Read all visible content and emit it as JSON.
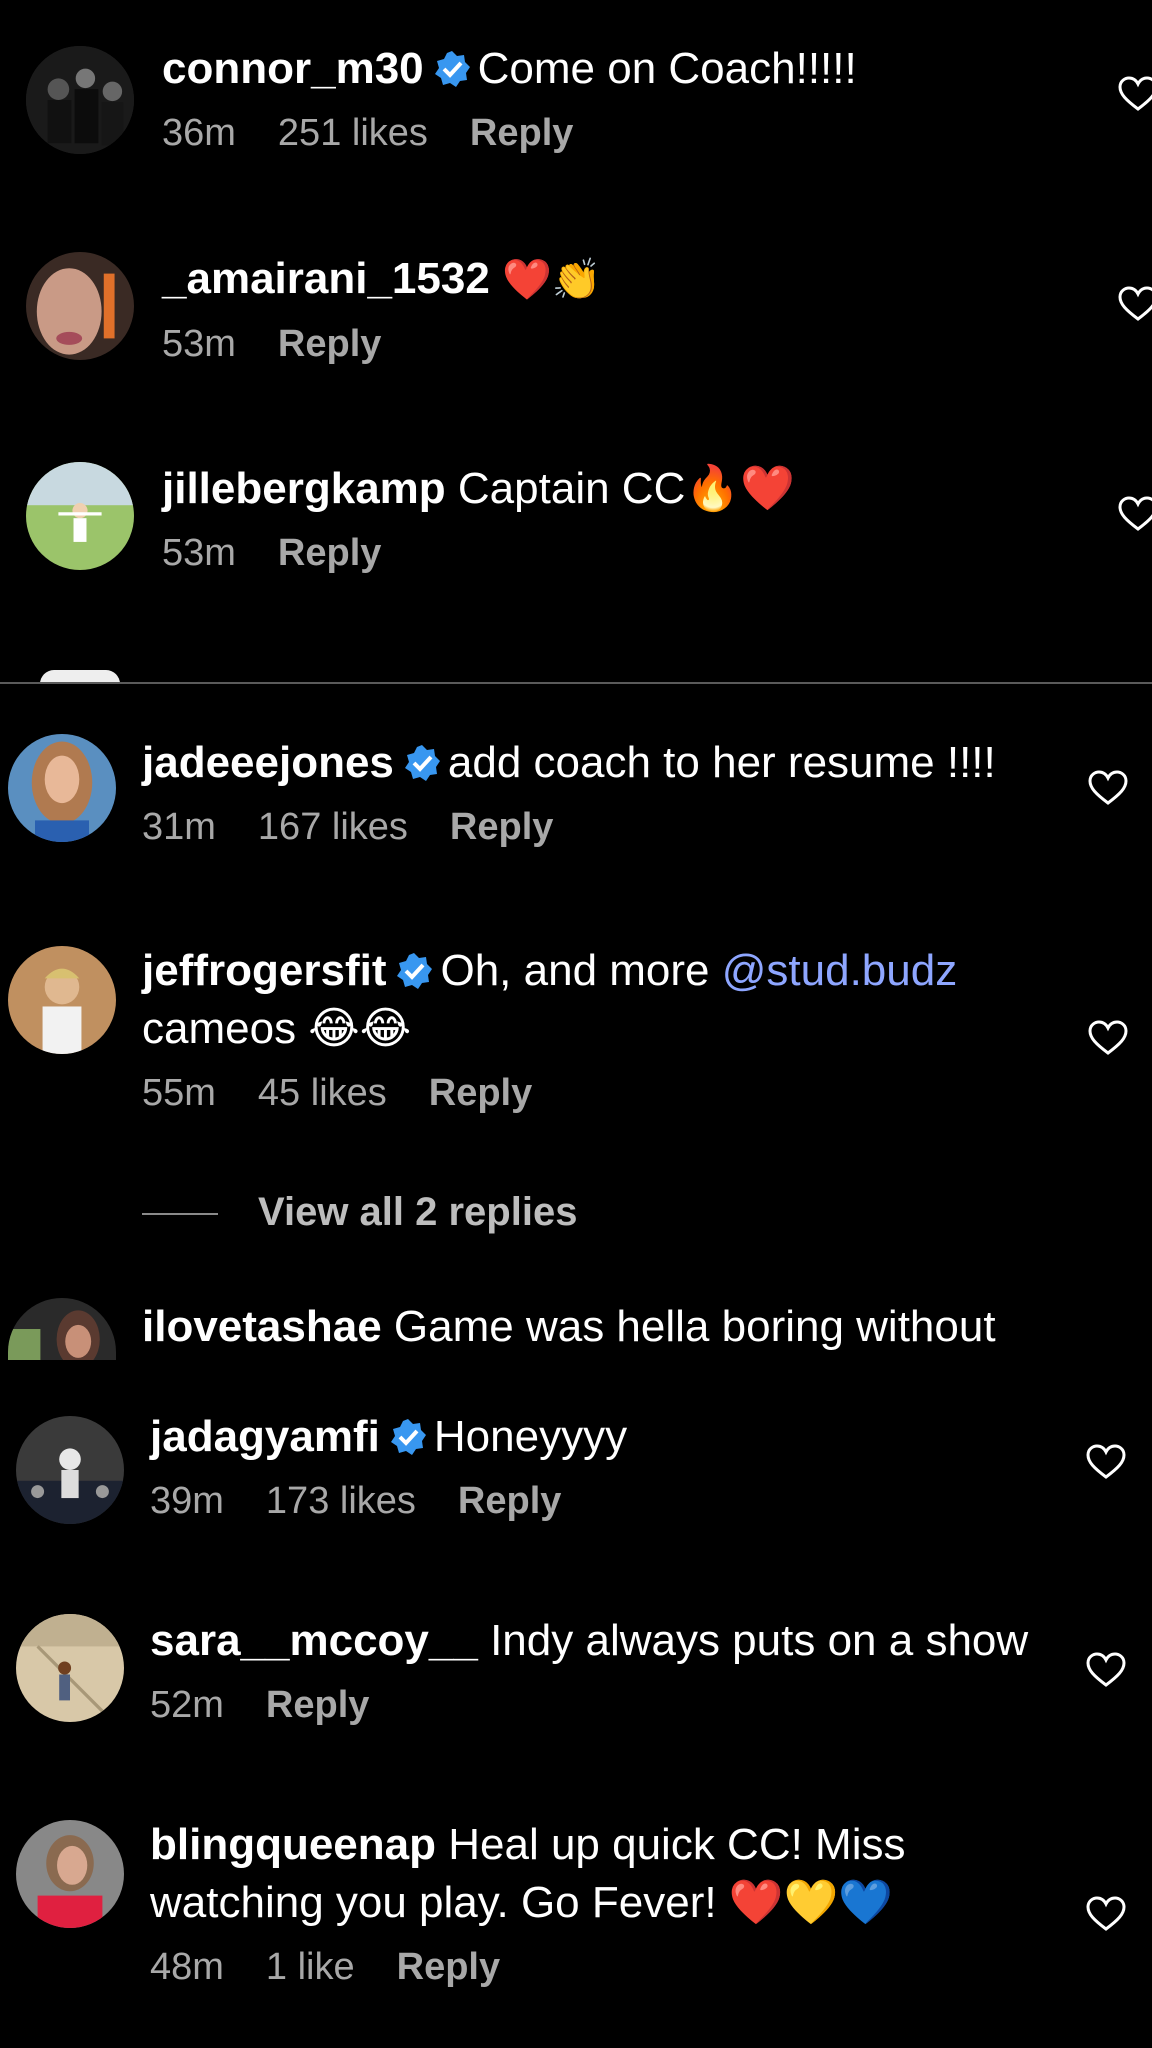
{
  "colors": {
    "background": "#000000",
    "text": "#ffffff",
    "meta": "#a8a8a8",
    "verified": "#3897f0",
    "mention": "#8ea6ff",
    "divider": "#5a5a5a"
  },
  "top_section": [
    {
      "username": "connor_m30",
      "verified": true,
      "text": "Come on Coach!!!!!",
      "time": "36m",
      "likes": "251 likes",
      "reply": "Reply"
    },
    {
      "username": "_amairani_1532",
      "verified": false,
      "text": "❤️👏",
      "time": "53m",
      "likes": "",
      "reply": "Reply"
    },
    {
      "username": "jillebergkamp",
      "verified": false,
      "text": "Captain CC🔥❤️",
      "time": "53m",
      "likes": "",
      "reply": "Reply"
    }
  ],
  "bottom_section": [
    {
      "username": "jadeeejones",
      "verified": true,
      "text": "add coach to her resume !!!!",
      "time": "31m",
      "likes": "167 likes",
      "reply": "Reply"
    },
    {
      "username": "jeffrogersfit",
      "verified": true,
      "text": "Oh, and more ",
      "mention": "@stud.budz",
      "text2": "cameos 😂😂",
      "time": "55m",
      "likes": "45 likes",
      "reply": "Reply"
    },
    {
      "username": "ilovetashae",
      "verified": false,
      "text": "Game was hella boring without"
    },
    {
      "username": "jadagyamfi",
      "verified": true,
      "text": "Honeyyyy",
      "time": "39m",
      "likes": "173 likes",
      "reply": "Reply"
    },
    {
      "username": "sara__mccoy__",
      "verified": false,
      "text": "Indy always puts on a show",
      "time": "52m",
      "likes": "",
      "reply": "Reply"
    },
    {
      "username": "blingqueenap",
      "verified": false,
      "text": "Heal up quick CC! Miss",
      "text2": "watching you play. Go Fever! ❤️💛💙",
      "time": "48m",
      "likes": "1 like",
      "reply": "Reply"
    }
  ],
  "view_replies": "View all 2 replies"
}
